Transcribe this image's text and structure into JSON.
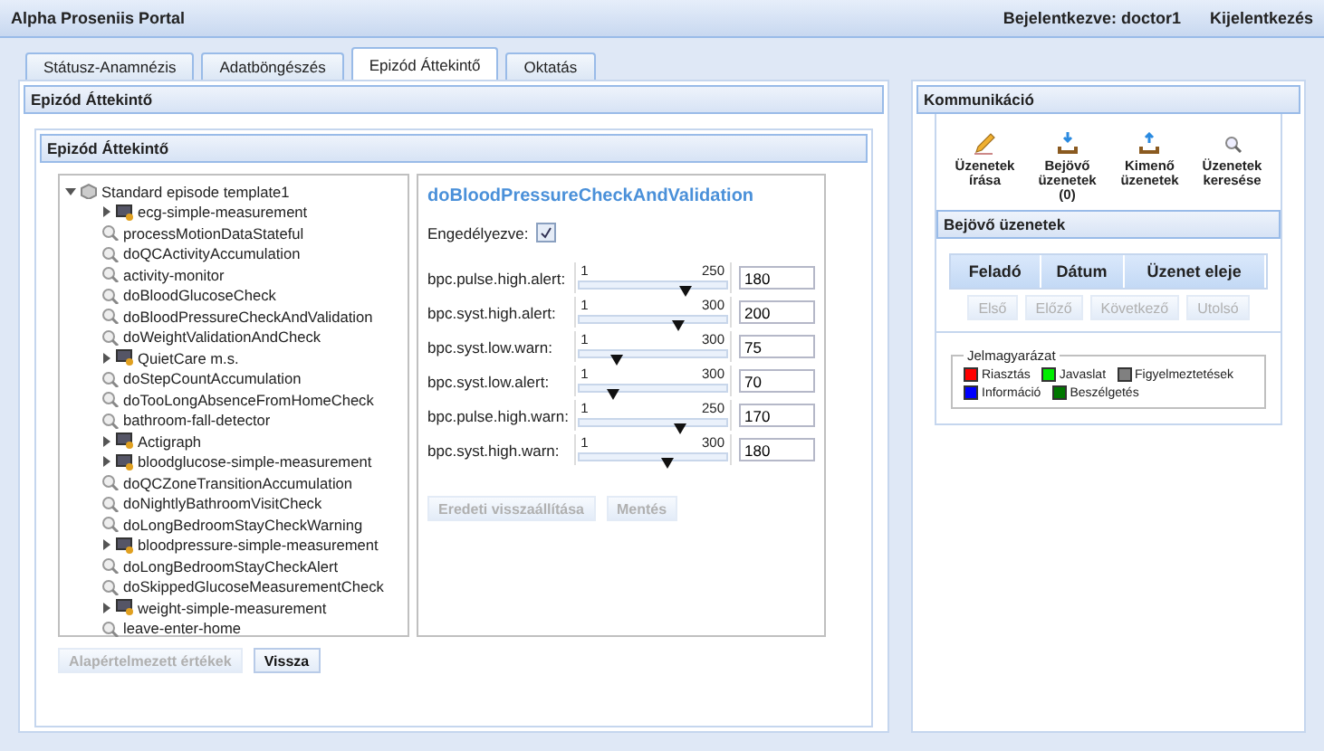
{
  "header": {
    "title": "Alpha Proseniis Portal",
    "user": "Bejelentkezve: doctor1",
    "logout": "Kijelentkezés"
  },
  "tabs": [
    {
      "label": "Státusz-Anamnézis",
      "selected": false
    },
    {
      "label": "Adatböngészés",
      "selected": false
    },
    {
      "label": "Epizód Áttekintő",
      "selected": true
    },
    {
      "label": "Oktatás",
      "selected": false
    }
  ],
  "main": {
    "title": "Epizód Áttekintő",
    "inner_title": "Epizód Áttekintő",
    "tree": {
      "label": "Standard episode template1",
      "expanded": true,
      "children": [
        {
          "kind": "group",
          "label": "ecg-simple-measurement",
          "expanded": false
        },
        {
          "kind": "rule",
          "label": "processMotionDataStateful"
        },
        {
          "kind": "rule",
          "label": "doQCActivityAccumulation"
        },
        {
          "kind": "rule",
          "label": "activity-monitor"
        },
        {
          "kind": "rule",
          "label": "doBloodGlucoseCheck"
        },
        {
          "kind": "rule",
          "label": "doBloodPressureCheckAndValidation"
        },
        {
          "kind": "rule",
          "label": "doWeightValidationAndCheck"
        },
        {
          "kind": "group",
          "label": "QuietCare m.s.",
          "expanded": false
        },
        {
          "kind": "rule",
          "label": "doStepCountAccumulation"
        },
        {
          "kind": "rule",
          "label": "doTooLongAbsenceFromHomeCheck"
        },
        {
          "kind": "rule",
          "label": "bathroom-fall-detector"
        },
        {
          "kind": "group",
          "label": "Actigraph",
          "expanded": false
        },
        {
          "kind": "group",
          "label": "bloodglucose-simple-measurement",
          "expanded": false
        },
        {
          "kind": "rule",
          "label": "doQCZoneTransitionAccumulation"
        },
        {
          "kind": "rule",
          "label": "doNightlyBathroomVisitCheck"
        },
        {
          "kind": "rule",
          "label": "doLongBedroomStayCheckWarning"
        },
        {
          "kind": "group",
          "label": "bloodpressure-simple-measurement",
          "expanded": false
        },
        {
          "kind": "rule",
          "label": "doLongBedroomStayCheckAlert"
        },
        {
          "kind": "rule",
          "label": "doSkippedGlucoseMeasurementCheck"
        },
        {
          "kind": "group",
          "label": "weight-simple-measurement",
          "expanded": false
        },
        {
          "kind": "rule",
          "label": "leave-enter-home"
        }
      ]
    },
    "detail": {
      "title": "doBloodPressureCheckAndValidation",
      "enabled_label": "Engedélyezve:",
      "enabled": true,
      "params": [
        {
          "name": "bpc.pulse.high.alert:",
          "min": "1",
          "max": "250",
          "level": 0.72,
          "value": "180"
        },
        {
          "name": "bpc.syst.high.alert:",
          "min": "1",
          "max": "300",
          "level": 0.67,
          "value": "200"
        },
        {
          "name": "bpc.syst.low.warn:",
          "min": "1",
          "max": "300",
          "level": 0.25,
          "value": "75"
        },
        {
          "name": "bpc.syst.low.alert:",
          "min": "1",
          "max": "300",
          "level": 0.23,
          "value": "70"
        },
        {
          "name": "bpc.pulse.high.warn:",
          "min": "1",
          "max": "250",
          "level": 0.68,
          "value": "170"
        },
        {
          "name": "bpc.syst.high.warn:",
          "min": "1",
          "max": "300",
          "level": 0.6,
          "value": "180"
        }
      ],
      "buttons": [
        {
          "label": "Eredeti visszaállítása",
          "disabled": true
        },
        {
          "label": "Mentés",
          "disabled": true
        }
      ]
    },
    "buttons": [
      {
        "label": "Alapértelmezett értékek",
        "disabled": true
      },
      {
        "label": "Vissza",
        "disabled": false
      }
    ]
  },
  "comm": {
    "title": "Kommunikáció",
    "actions": [
      {
        "kind": "write",
        "label": "Üzenetek írása"
      },
      {
        "kind": "inbox",
        "label": "Bejövő üzenetek (0)"
      },
      {
        "kind": "outbox",
        "label": "Kimenő üzenetek"
      },
      {
        "kind": "search",
        "label": "Üzenetek keresése"
      }
    ],
    "inbox_title": "Bejövő üzenetek",
    "columns": [
      "Feladó",
      "Dátum",
      "Üzenet eleje"
    ],
    "pager": [
      {
        "label": "Első",
        "disabled": true
      },
      {
        "label": "Előző",
        "disabled": true
      },
      {
        "label": "Következő",
        "disabled": true
      },
      {
        "label": "Utolsó",
        "disabled": true
      }
    ],
    "legend_title": "Jelmagyarázat",
    "legend": [
      {
        "label": "Riasztás",
        "color": "#ff0000"
      },
      {
        "label": "Javaslat",
        "color": "#00ee00"
      },
      {
        "label": "Figyelmeztetések",
        "color": "#808080"
      },
      {
        "label": "Információ",
        "color": "#0000ff"
      },
      {
        "label": "Beszélgetés",
        "color": "#007700"
      }
    ]
  }
}
